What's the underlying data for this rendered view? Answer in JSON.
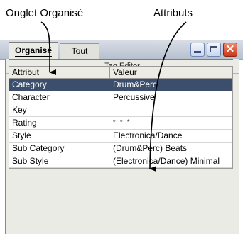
{
  "callouts": {
    "left": "Onglet Organisé",
    "right": "Attributs"
  },
  "window": {
    "title": "Tag Editor",
    "tabs": [
      {
        "label": "Organisé",
        "active": true
      },
      {
        "label": "Tout",
        "active": false
      }
    ],
    "columns": [
      "Attribut",
      "Valeur"
    ],
    "rows": [
      {
        "attribute": "Category",
        "value": "Drum&Perc",
        "selected": true
      },
      {
        "attribute": "Character",
        "value": "Percussive"
      },
      {
        "attribute": "Key",
        "value": ""
      },
      {
        "attribute": "Rating",
        "value": "* * *"
      },
      {
        "attribute": "Style",
        "value": "Electronica/Dance"
      },
      {
        "attribute": "Sub Category",
        "value": "(Drum&Perc) Beats"
      },
      {
        "attribute": "Sub Style",
        "value": "(Electronica/Dance) Minimal"
      }
    ]
  },
  "colors": {
    "selection": "#3b4f6c",
    "close_button": "#d9472a"
  }
}
